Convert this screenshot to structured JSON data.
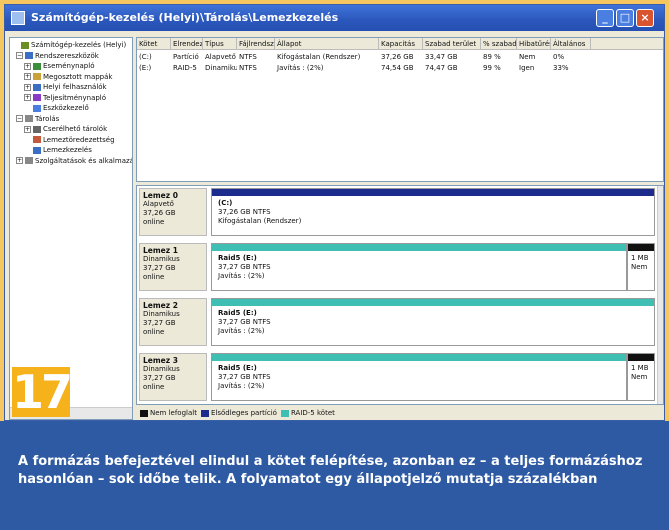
{
  "window": {
    "title": "Számítógép-kezelés (Helyi)\\Tárolás\\Lemezkezelés",
    "controls": [
      "_",
      "□",
      "×"
    ]
  },
  "tree": {
    "items": [
      {
        "label": "Számítógép-kezelés (Helyi)",
        "icon_color": "#6b8e23",
        "exp": ""
      },
      {
        "label": "Rendszereszközök",
        "icon_color": "#3b6fc4",
        "exp": "−"
      },
      {
        "label": "Eseménynapló",
        "icon_color": "#3b8f3b",
        "exp": "+"
      },
      {
        "label": "Megosztott mappák",
        "icon_color": "#c9a23a",
        "exp": "+"
      },
      {
        "label": "Helyi felhasználók",
        "icon_color": "#3b6fc4",
        "exp": "+"
      },
      {
        "label": "Teljesítménynapló",
        "icon_color": "#8a3bc4",
        "exp": "+"
      },
      {
        "label": "Eszközkezelő",
        "icon_color": "#4a7ee0",
        "exp": ""
      },
      {
        "label": "Tárolás",
        "icon_color": "#888888",
        "exp": "−"
      },
      {
        "label": "Cserélhető tárolók",
        "icon_color": "#666666",
        "exp": "+"
      },
      {
        "label": "Lemeztöredezettség",
        "icon_color": "#c45a3b",
        "exp": ""
      },
      {
        "label": "Lemezkezelés",
        "icon_color": "#3b6fc4",
        "exp": ""
      },
      {
        "label": "Szolgáltatások és alkalmazások",
        "icon_color": "#888888",
        "exp": "+"
      }
    ]
  },
  "volume_list": {
    "columns": [
      "Kötet",
      "Elrendezés",
      "Típus",
      "Fájlrendszer",
      "Állapot",
      "Kapacitás",
      "Szabad terület",
      "% szabad",
      "Hibatűrés",
      "Általános"
    ],
    "rows": [
      [
        "(C:)",
        "Partíció",
        "Alapvető",
        "NTFS",
        "Kifogástalan (Rendszer)",
        "37,26 GB",
        "33,47 GB",
        "89 %",
        "Nem",
        "0%"
      ],
      [
        "(E:)",
        "RAID-5",
        "Dinamikus",
        "NTFS",
        "Javítás : (2%)",
        "74,54 GB",
        "74,47 GB",
        "99 %",
        "Igen",
        "33%"
      ]
    ]
  },
  "disks": [
    {
      "name": "Lemez 0",
      "type": "Alapvető",
      "size": "37,26 GB",
      "status": "online",
      "volume": {
        "title": "(C:)",
        "line2": "37,26 GB NTFS",
        "line3": "Kifogástalan (Rendszer)",
        "bar_color": "#1c2c8c"
      },
      "unallocated": null
    },
    {
      "name": "Lemez 1",
      "type": "Dinamikus",
      "size": "37,27 GB",
      "status": "online",
      "volume": {
        "title": "Raid5 (E:)",
        "line2": "37,27 GB NTFS",
        "line3": "Javítás : (2%)",
        "bar_color": "#3fbfb4"
      },
      "unallocated": {
        "line1": "1 MB",
        "line2": "Nem"
      }
    },
    {
      "name": "Lemez 2",
      "type": "Dinamikus",
      "size": "37,27 GB",
      "status": "online",
      "volume": {
        "title": "Raid5 (E:)",
        "line2": "37,27 GB NTFS",
        "line3": "Javítás : (2%)",
        "bar_color": "#3fbfb4"
      },
      "unallocated": null
    },
    {
      "name": "Lemez 3",
      "type": "Dinamikus",
      "size": "37,27 GB",
      "status": "online",
      "volume": {
        "title": "Raid5 (E:)",
        "line2": "37,27 GB NTFS",
        "line3": "Javítás : (2%)",
        "bar_color": "#3fbfb4"
      },
      "unallocated": {
        "line1": "1 MB",
        "line2": "Nem"
      }
    }
  ],
  "legend": [
    {
      "label": "Nem lefoglalt",
      "color": "#111111"
    },
    {
      "label": "Elsődleges partíció",
      "color": "#1c2c8c"
    },
    {
      "label": "RAID-5 kötet",
      "color": "#3fbfb4"
    }
  ],
  "badge": {
    "number": "17"
  },
  "caption": {
    "text": "A formázás befejeztével elindul a kötet felépítése, azonban ez – a teljes formázáshoz hasonlóan – sok időbe telik. A folyamatot egy állapotjelző mutatja százalékban"
  }
}
